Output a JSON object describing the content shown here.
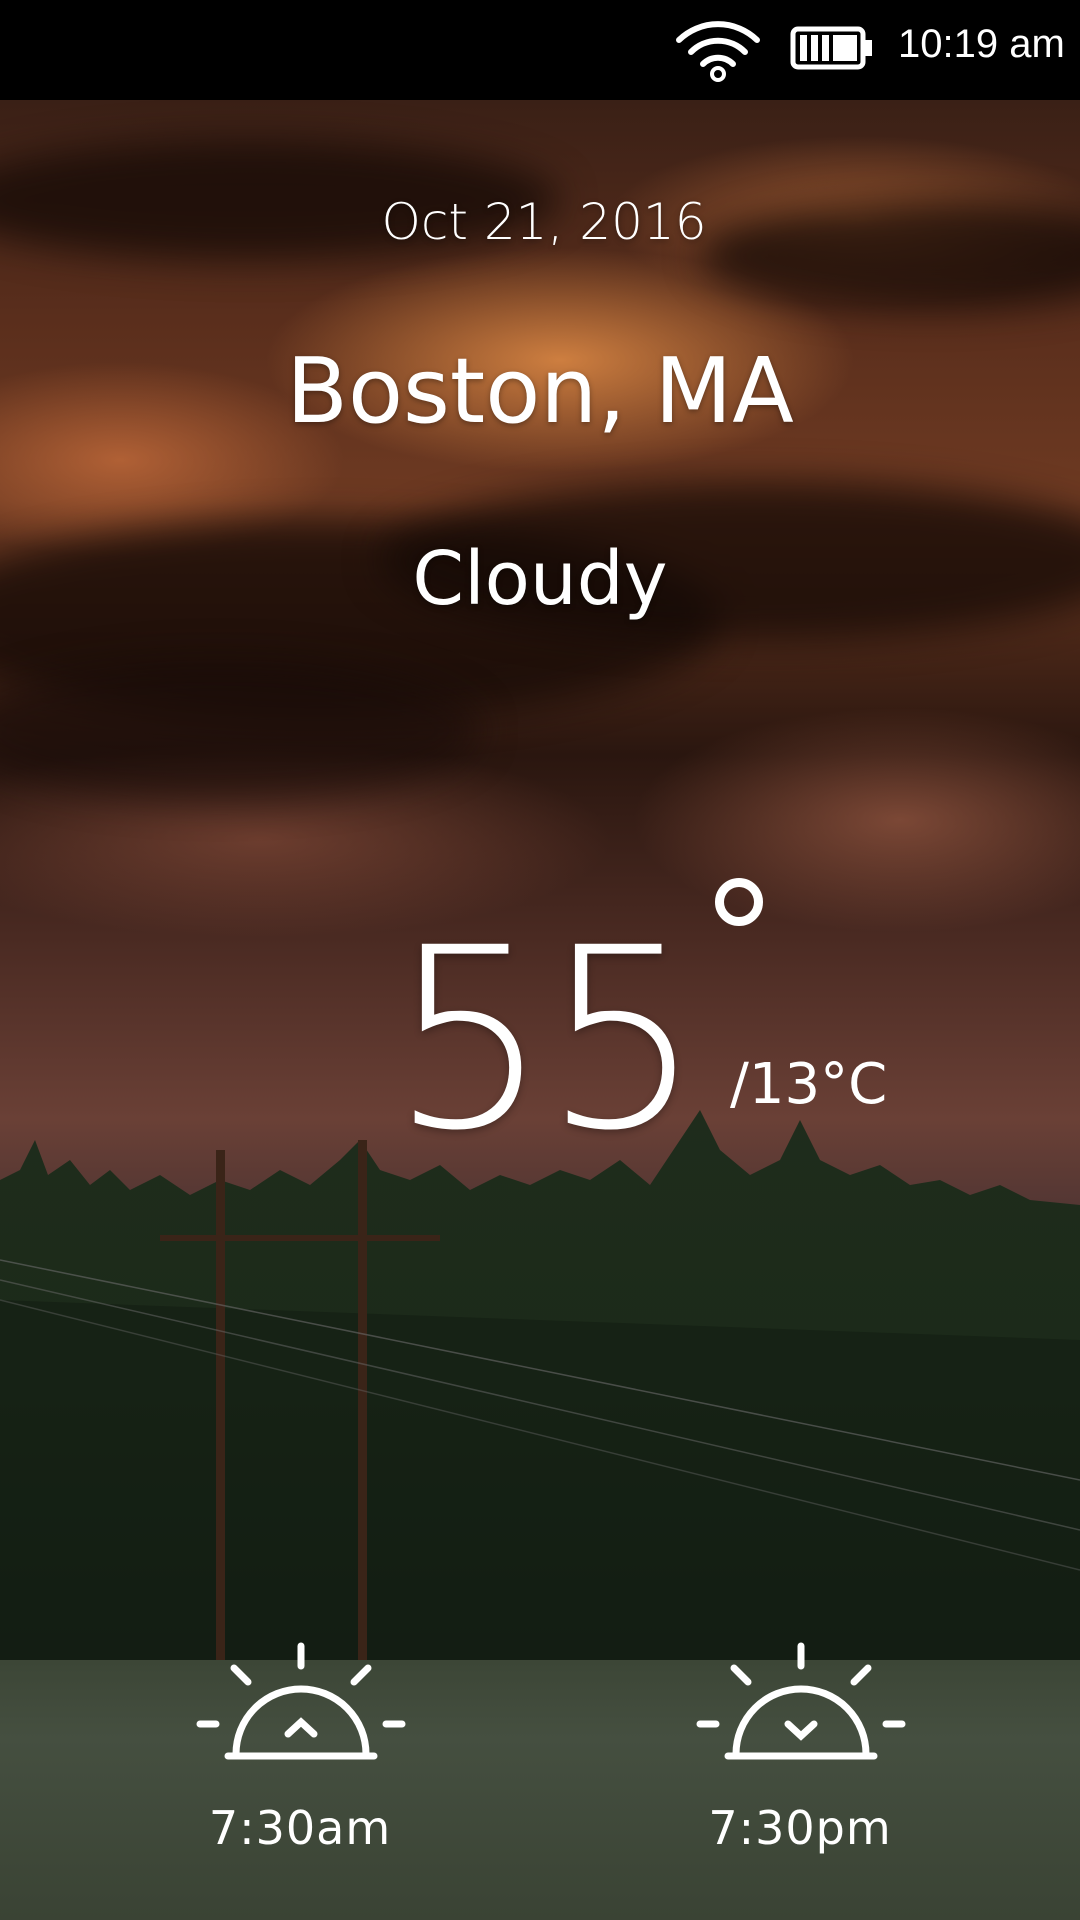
{
  "status_bar": {
    "time": "10:19 am",
    "icons": [
      "wifi-icon",
      "battery-icon"
    ]
  },
  "weather": {
    "date": "Oct 21, 2016",
    "location": "Boston, MA",
    "condition": "Cloudy",
    "temperature_f": "55",
    "temperature_c": "/13°C",
    "sunrise_time": "7:30am",
    "sunset_time": "7:30pm"
  },
  "icons": {
    "sunrise": "sunrise-icon",
    "sunset": "sunset-icon"
  },
  "colors": {
    "text": "#ffffff",
    "status_bar_bg": "#000000"
  }
}
